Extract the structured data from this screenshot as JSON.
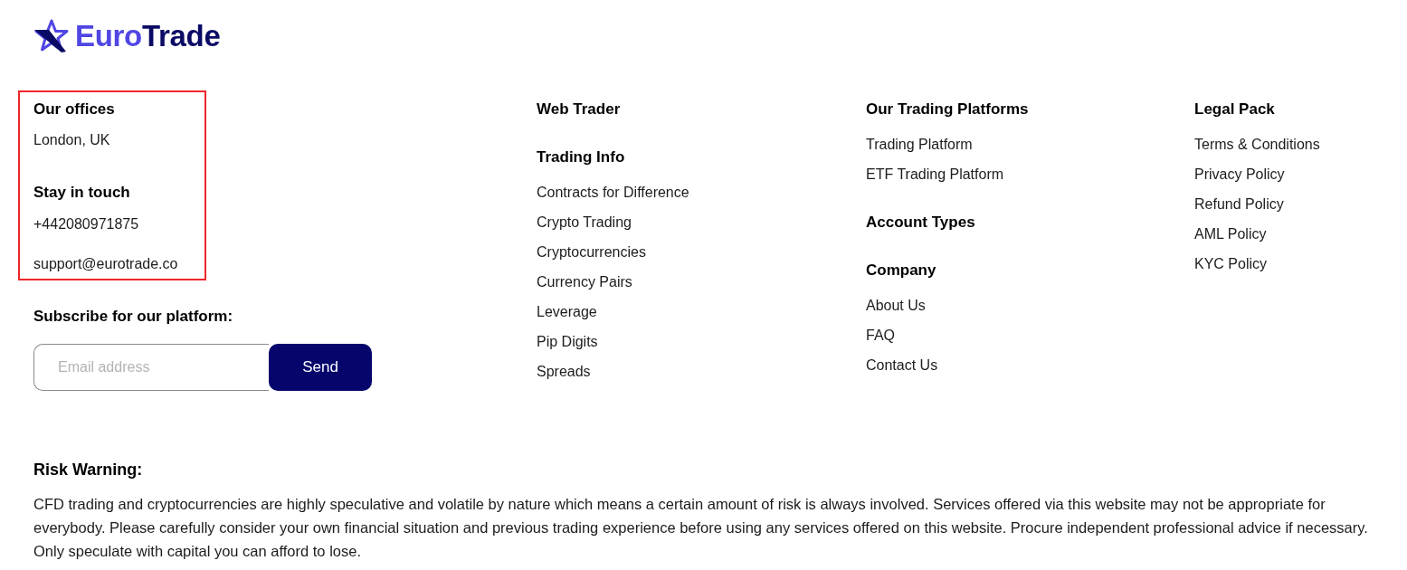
{
  "logo": {
    "parts": [
      "Euro",
      "Trade"
    ]
  },
  "contact": {
    "highlighted": true,
    "sections": [
      {
        "heading": "Our offices",
        "lines": [
          "London, UK"
        ]
      },
      {
        "heading": "Stay in touch",
        "lines": [
          "+442080971875",
          "support@eurotrade.co"
        ]
      }
    ]
  },
  "subscribe": {
    "heading": "Subscribe for our platform:",
    "placeholder": "Email address",
    "button": "Send"
  },
  "columns": [
    {
      "groups": [
        {
          "heading": "Web Trader"
        },
        {
          "heading": "Trading Info",
          "links": [
            "Contracts for Difference",
            "Crypto Trading",
            "Cryptocurrencies",
            "Currency Pairs",
            "Leverage",
            "Pip Digits",
            "Spreads"
          ]
        }
      ]
    },
    {
      "groups": [
        {
          "heading": "Our Trading Platforms",
          "links": [
            "Trading Platform",
            "ETF Trading Platform"
          ]
        },
        {
          "heading": "Account Types"
        },
        {
          "heading": "Company",
          "links": [
            "About Us",
            "FAQ",
            "Contact Us"
          ]
        }
      ]
    },
    {
      "groups": [
        {
          "heading": "Legal Pack",
          "links": [
            "Terms & Conditions",
            "Privacy Policy",
            "Refund Policy",
            "AML Policy",
            "KYC Policy"
          ]
        }
      ]
    }
  ],
  "risk_warning": {
    "heading": "Risk Warning:",
    "text": "CFD trading and cryptocurrencies are highly speculative and volatile by nature which means a certain amount of risk is always involved. Services offered via this website may not be appropriate for everybody. Please carefully consider your own financial situation and previous trading experience before using any services offered on this website. Procure independent professional advice if necessary. Only speculate with capital you can afford to lose."
  }
}
